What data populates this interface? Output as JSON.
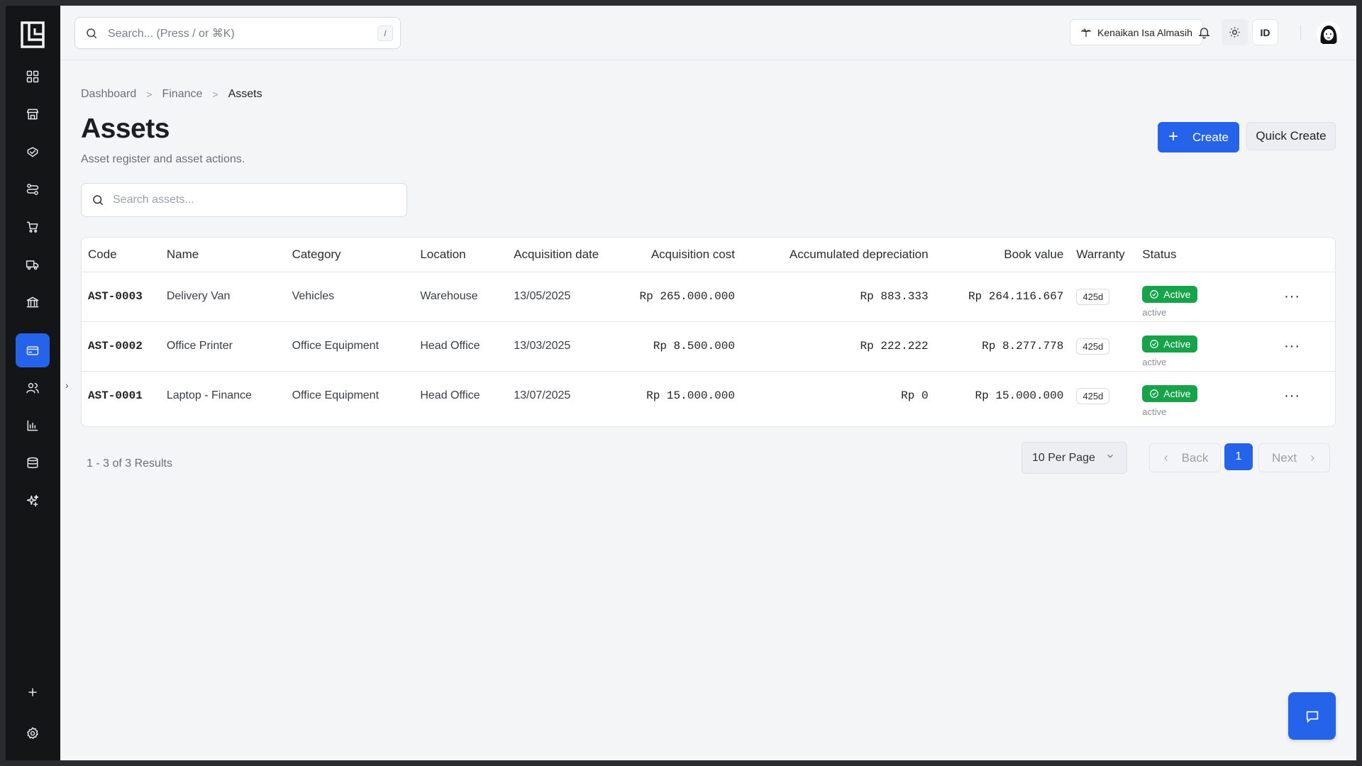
{
  "header": {
    "search_placeholder": "Search... (Press / or ⌘K)",
    "search_shortcut": "/",
    "holiday_label": "Kenaikan Isa Almasih",
    "language": "ID"
  },
  "sidebar": {
    "items": [
      {
        "icon": "dashboard-icon"
      },
      {
        "icon": "store-icon"
      },
      {
        "icon": "handshake-icon"
      },
      {
        "icon": "workflow-icon"
      },
      {
        "icon": "cart-icon"
      },
      {
        "icon": "truck-icon"
      },
      {
        "icon": "bank-icon"
      },
      {
        "icon": "card-icon",
        "active": true
      },
      {
        "icon": "users-icon"
      },
      {
        "icon": "chart-icon"
      },
      {
        "icon": "database-icon"
      },
      {
        "icon": "sparkles-icon"
      }
    ],
    "bottom": [
      {
        "icon": "plus-icon"
      },
      {
        "icon": "settings-icon"
      }
    ]
  },
  "breadcrumb": [
    "Dashboard",
    "Finance",
    "Assets"
  ],
  "page": {
    "title": "Assets",
    "subtitle": "Asset register and asset actions.",
    "create_label": "Create",
    "quick_create_label": "Quick Create",
    "search_placeholder": "Search assets..."
  },
  "table": {
    "columns": [
      "Code",
      "Name",
      "Category",
      "Location",
      "Acquisition date",
      "Acquisition cost",
      "Accumulated depreciation",
      "Book value",
      "Warranty",
      "Status"
    ],
    "rows": [
      {
        "code": "AST-0003",
        "name": "Delivery Van",
        "category": "Vehicles",
        "location": "Warehouse",
        "date": "13/05/2025",
        "cost": "Rp 265.000.000",
        "depreciation": "Rp 883.333",
        "book_value": "Rp 264.116.667",
        "warranty": "425d",
        "status": "Active",
        "status_sub": "active"
      },
      {
        "code": "AST-0002",
        "name": "Office Printer",
        "category": "Office Equipment",
        "location": "Head Office",
        "date": "13/03/2025",
        "cost": "Rp 8.500.000",
        "depreciation": "Rp 222.222",
        "book_value": "Rp 8.277.778",
        "warranty": "425d",
        "status": "Active",
        "status_sub": "active"
      },
      {
        "code": "AST-0001",
        "name": "Laptop - Finance",
        "category": "Office Equipment",
        "location": "Head Office",
        "date": "13/07/2025",
        "cost": "Rp 15.000.000",
        "depreciation": "Rp 0",
        "book_value": "Rp 15.000.000",
        "warranty": "425d",
        "status": "Active",
        "status_sub": "active"
      }
    ]
  },
  "pagination": {
    "results": "1 - 3 of 3 Results",
    "per_page": "10 Per Page",
    "back": "Back",
    "current": "1",
    "next": "Next"
  },
  "colors": {
    "accent": "#2563eb",
    "success": "#16a34a",
    "sidebar": "#141517"
  }
}
